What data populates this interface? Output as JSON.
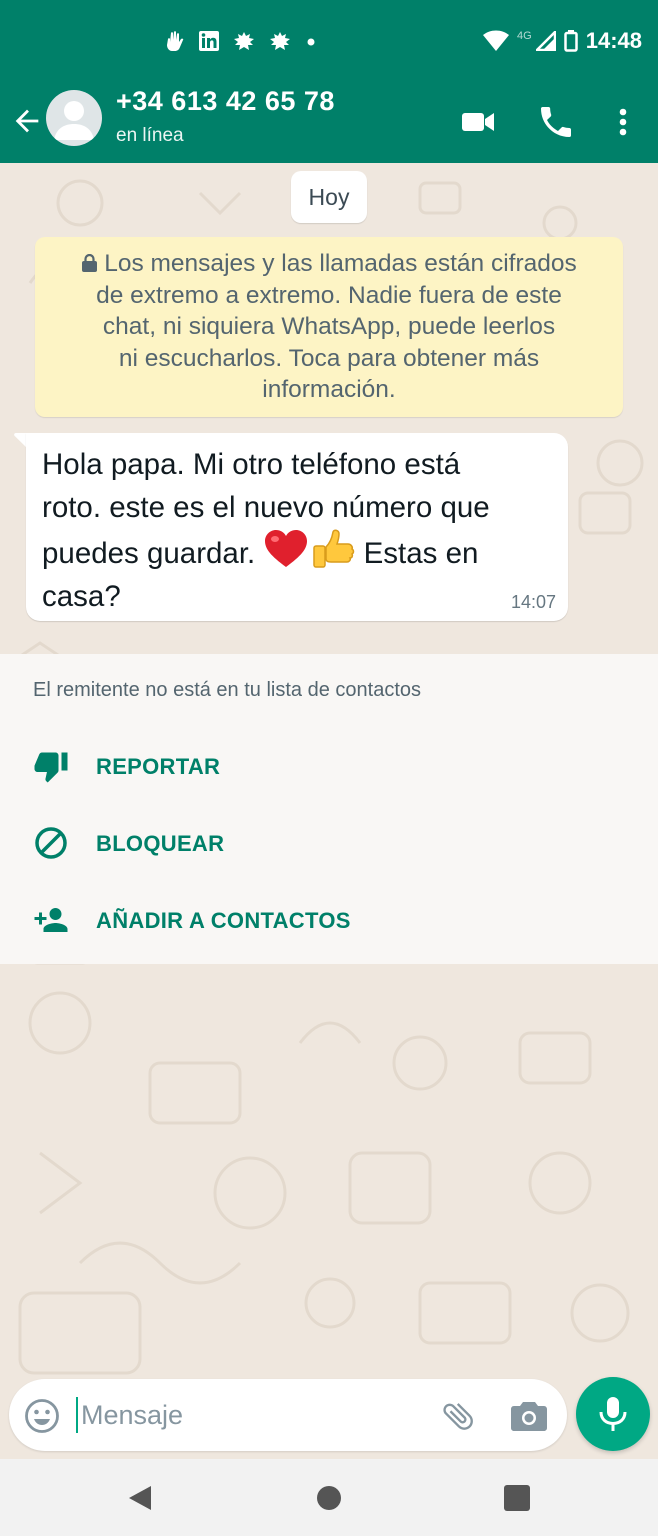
{
  "status_bar": {
    "time": "14:48",
    "network": "4G",
    "notification_icons": [
      "hand-icon",
      "linkedin-icon",
      "leaf-icon",
      "leaf-icon",
      "dot-icon"
    ],
    "system_icons": [
      "wifi-icon",
      "signal-icon",
      "battery-icon"
    ]
  },
  "header": {
    "contact_name": "+34 613 42 65 78",
    "status": "en línea",
    "icons": [
      "back-arrow-icon",
      "avatar",
      "video-call-icon",
      "phone-icon",
      "more-vert-icon"
    ]
  },
  "chat": {
    "date_chip": "Hoy",
    "encryption_notice": {
      "lines": [
        "Los mensajes y las llamadas están cifrados",
        "de extremo a extremo. Nadie fuera de este",
        "chat, ni siquiera WhatsApp, puede leerlos",
        "ni escucharlos. Toca para obtener más",
        "información."
      ]
    },
    "messages": [
      {
        "lines_a": [
          "Hola papa.  Mi otro teléfono está",
          "roto. este es el nuevo número que"
        ],
        "line_c_before": "puedes guardar. ",
        "emojis": [
          "red-heart",
          "thumbs-up"
        ],
        "line_c_after": "  Estas en",
        "line_d": "casa?",
        "time": "14:07",
        "direction": "incoming"
      }
    ]
  },
  "unknown_sender_panel": {
    "title": "El remitente no está en tu lista de contactos",
    "actions": [
      {
        "label": "REPORTAR",
        "icon": "thumb-down-icon"
      },
      {
        "label": "BLOQUEAR",
        "icon": "block-icon"
      },
      {
        "label": "AÑADIR A CONTACTOS",
        "icon": "add-person-icon"
      }
    ]
  },
  "composer": {
    "placeholder": "Mensaje",
    "value": ""
  },
  "colors": {
    "brand_green": "#008069",
    "accent_green": "#00a884",
    "chat_background": "#efe7de",
    "notice_background": "#fdf4c5"
  }
}
